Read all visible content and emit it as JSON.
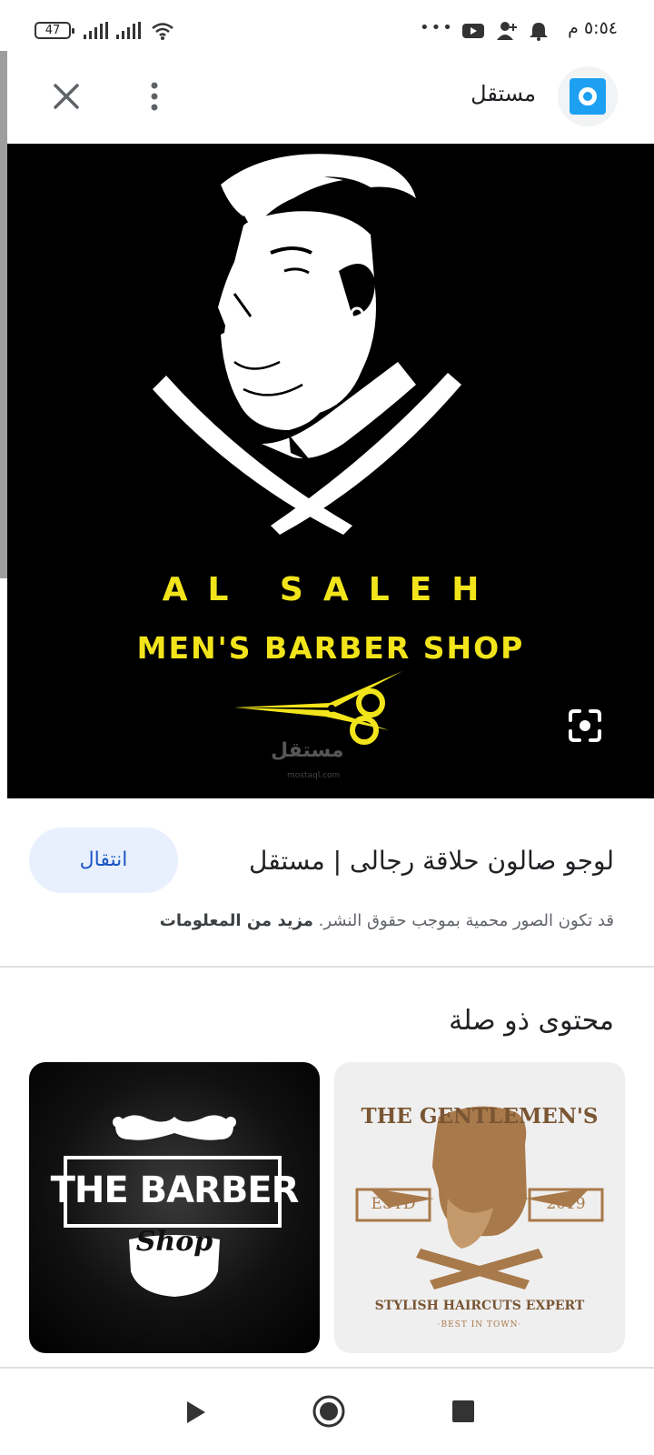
{
  "status_bar": {
    "time": "٥:٥٤ م",
    "battery": "47",
    "more_dots": "•••"
  },
  "top_bar": {
    "source_name": "مستقل"
  },
  "main_image": {
    "brand_line1": "AL SALEH",
    "brand_line2": "MEN'S BARBER SHOP",
    "watermark": "مستقل",
    "watermark_sub": "mostaql.com"
  },
  "result": {
    "title": "لوجو صالون حلاقة رجالى | مستقل",
    "visit_label": "انتقال",
    "copyright_text": "قد تكون الصور محمية بموجب حقوق النشر.",
    "more_info_label": "مزيد من المعلومات"
  },
  "related": {
    "heading": "محتوى ذو صلة",
    "cards": [
      {
        "title": "THE BARBER",
        "script": "Shop"
      },
      {
        "arc_top": "THE GENTLEMEN'S",
        "estd": "ESTD",
        "year": "2019",
        "arc_bottom": "STYLISH HAIRCUTS EXPERT",
        "tagline": "·BEST IN TOWN·"
      }
    ]
  },
  "colors": {
    "accent_yellow": "#f2e41b",
    "visit_bg": "#e8f0fe",
    "visit_text": "#1a56c4",
    "logo_blue": "#1da0f2",
    "gentlemen_brown": "#a8794a"
  }
}
